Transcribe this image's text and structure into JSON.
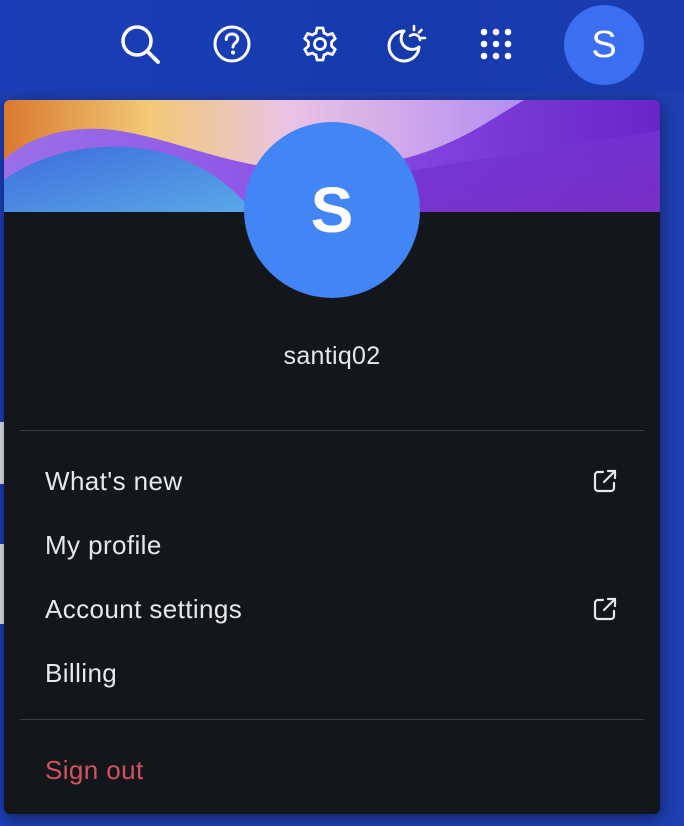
{
  "topbar": {
    "icons": [
      "search-icon",
      "help-icon",
      "settings-icon",
      "theme-toggle-icon",
      "apps-grid-icon"
    ],
    "avatar_initial": "S"
  },
  "account_menu": {
    "avatar_initial": "S",
    "username": "santiq02",
    "items": [
      {
        "label": "What's new",
        "external": true
      },
      {
        "label": "My profile",
        "external": false
      },
      {
        "label": "Account settings",
        "external": true
      },
      {
        "label": "Billing",
        "external": false
      }
    ],
    "sign_out_label": "Sign out"
  },
  "colors": {
    "topbar_bg": "#163aac",
    "panel_bg": "#13161b",
    "avatar_bg": "#4285f4",
    "sign_out": "#d2545d"
  }
}
